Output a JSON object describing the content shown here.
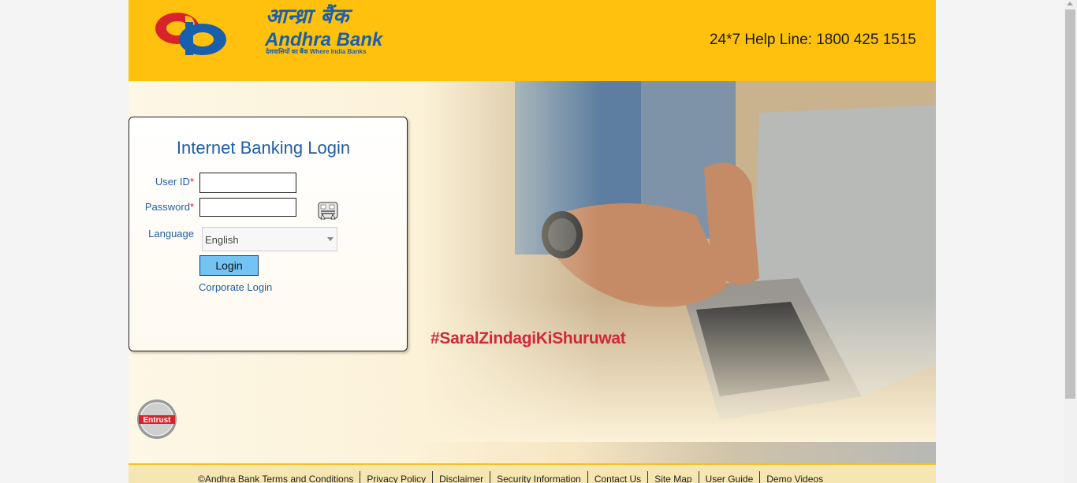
{
  "header": {
    "logo_hindi": "आन्ध्रा बैंक",
    "logo_name": "Andhra Bank",
    "logo_tagline": "देशवासियों का बैंक  Where India Banks",
    "helpline": "24*7 Help Line: 1800 425 1515"
  },
  "login": {
    "title": "Internet Banking Login",
    "userid_label": "User ID",
    "password_label": "Password",
    "required_mark": "*",
    "userid_value": "",
    "password_value": "",
    "language_label": "Language",
    "language_value": "English",
    "login_button": "Login",
    "corporate_link": "Corporate Login"
  },
  "hero": {
    "hashtag": "#SaralZindagiKiShuruwat"
  },
  "badge": {
    "text": "Entrust"
  },
  "footer": {
    "links": [
      "©Andhra Bank Terms and Conditions",
      "Privacy Policy",
      "Disclaimer",
      "Security Information",
      "Contact Us",
      "Site Map",
      "User Guide",
      "Demo Videos"
    ]
  },
  "colors": {
    "brand_yellow": "#ffc10e",
    "brand_blue": "#1a5fad",
    "brand_red": "#d8232a",
    "button_blue": "#73c3f3"
  }
}
